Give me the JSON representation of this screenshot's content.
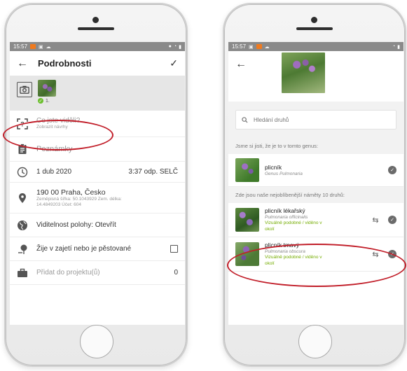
{
  "left": {
    "status_time": "15:57",
    "app_title": "Podrobnosti",
    "photo_count": "1.",
    "what_seen": {
      "title": "Co jste viděli?",
      "subtitle": "Zobrazit návrhy"
    },
    "notes": "Poznámky",
    "date": "1 dub 2020",
    "time": "3:37 odp. SELČ",
    "location": {
      "place": "190 00 Praha, Česko",
      "coords_line1": "Zeměpisná šířka: 50.1043929 Zem. délka:",
      "coords_line2": "14.4849203 Účet: 604"
    },
    "visibility": "Viditelnost polohy: Otevřít",
    "captive": "Žije v zajetí nebo je pěstované",
    "project": "Přidat do projektu(ů)",
    "project_count": "0"
  },
  "right": {
    "status_time": "15:57",
    "search_placeholder": "Hledání druhů",
    "genus_label": "Jsme si jisti, že je to v tomto genus:",
    "genus": {
      "name": "plicník",
      "sci": "Genus Pulmonaria"
    },
    "top_label": "Zde jsou naše nejoblíbenější náměty 10 druhů:",
    "suggestions": [
      {
        "name": "plicník lékařský",
        "sci": "Pulmonaria officinalis",
        "note_1": "Vizuálně podobné / viděno v",
        "note_2": "okolí"
      },
      {
        "name": "plicník tmavý",
        "sci": "Pulmonaria obscura",
        "note_1": "Vizuálně podobné / viděno v",
        "note_2": "okolí"
      }
    ]
  },
  "colors": {
    "highlight_oval": "#c11d28",
    "green_text": "#74ac00",
    "status_orange": "#f07a1e"
  }
}
